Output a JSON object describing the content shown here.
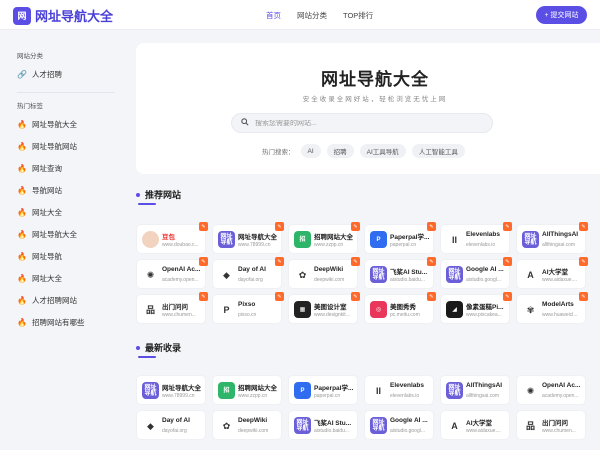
{
  "header": {
    "logo_mark": "网",
    "logo_text": "网址导航大全",
    "nav": [
      "首页",
      "网站分类",
      "TOP排行"
    ],
    "submit_label": "+ 提交网站"
  },
  "sidebar": {
    "category_title": "网站分类",
    "category_item": "人才招聘",
    "hot_title": "热门标签",
    "hot_items": [
      "网址导航大全",
      "网址导航网站",
      "网址查询",
      "导航网站",
      "网址大全",
      "网址导航大全",
      "网址导航",
      "网址大全",
      "人才招聘网站",
      "招聘网站有哪些"
    ]
  },
  "hero": {
    "title": "网址导航大全",
    "subtitle": "安全收录全网好站，轻松浏览无忧上网",
    "search_placeholder": "搜索您需要的网站...",
    "hot_label": "热门搜索：",
    "hot_tags": [
      "AI",
      "招聘",
      "AI工具导航",
      "人工智能工具"
    ]
  },
  "recommended": {
    "title": "推荐网站",
    "cards": [
      {
        "name": "豆包",
        "url": "www.doubao.c...",
        "icon": "doubao-icon",
        "color": "#f2d3c0",
        "mark": "",
        "red": true
      },
      {
        "name": "网址导航大全",
        "url": "www.78999.cn",
        "icon": "wangzhi-icon",
        "color": "#6a5fd8",
        "mark": "网址\n导航"
      },
      {
        "name": "招聘网站大全",
        "url": "www.zzpp.cn",
        "icon": "zhaopin-icon",
        "color": "#2fb56a",
        "mark": "招"
      },
      {
        "name": "Paperpal学...",
        "url": "paperpal.cn",
        "icon": "paperpal-icon",
        "color": "#2f6cf0",
        "mark": "P"
      },
      {
        "name": "Elevenlabs",
        "url": "elevenlabs.io",
        "icon": "elevenlabs-icon",
        "color": "#ffffff",
        "mark": "II"
      },
      {
        "name": "AllThingsAI",
        "url": "allthingsai.com",
        "icon": "allthingsai-icon",
        "color": "#6a5fd8",
        "mark": "网址\n导航"
      },
      {
        "name": "OpenAI Ac...",
        "url": "academy.open...",
        "icon": "openai-icon",
        "color": "#ffffff",
        "mark": "✺"
      },
      {
        "name": "Day of AI",
        "url": "dayofai.org",
        "icon": "dayofai-icon",
        "color": "#ffffff",
        "mark": "◆"
      },
      {
        "name": "DeepWiki",
        "url": "deepwiki.com",
        "icon": "deepwiki-icon",
        "color": "#ffffff",
        "mark": "✿"
      },
      {
        "name": "飞桨AI Stu...",
        "url": "aistudio.baidu...",
        "icon": "feijiang-icon",
        "color": "#6a5fd8",
        "mark": "网址\n导航"
      },
      {
        "name": "Google AI ...",
        "url": "aistudio.googl...",
        "icon": "googleai-icon",
        "color": "#6a5fd8",
        "mark": "网址\n导航"
      },
      {
        "name": "AI大学堂",
        "url": "www.aidaxue....",
        "icon": "aidaxue-icon",
        "color": "#ffffff",
        "mark": "A"
      },
      {
        "name": "出门问问",
        "url": "www.chumen...",
        "icon": "chumen-icon",
        "color": "#ffffff",
        "mark": "品"
      },
      {
        "name": "Pixso",
        "url": "pixso.cn",
        "icon": "pixso-icon",
        "color": "#ffffff",
        "mark": "P"
      },
      {
        "name": "美图设计室",
        "url": "www.designkit...",
        "icon": "meitu-design-icon",
        "color": "#222222",
        "mark": "▦"
      },
      {
        "name": "美图秀秀",
        "url": "pc.meitu.com",
        "icon": "meitu-icon",
        "color": "#e8375a",
        "mark": "◎"
      },
      {
        "name": "像素蛋糕Pi...",
        "url": "www.pixcakea...",
        "icon": "pixcake-icon",
        "color": "#1a1a1a",
        "mark": "◢"
      },
      {
        "name": "ModelArts",
        "url": "www.huaweicl...",
        "icon": "modelarts-icon",
        "color": "#ffffff",
        "mark": "✾"
      }
    ]
  },
  "latest": {
    "title": "最新收录",
    "cards": [
      {
        "name": "网址导航大全",
        "url": "www.78999.cn",
        "icon": "wangzhi-icon",
        "color": "#6a5fd8",
        "mark": "网址\n导航"
      },
      {
        "name": "招聘网站大全",
        "url": "www.zzpp.cn",
        "icon": "zhaopin-icon",
        "color": "#2fb56a",
        "mark": "招"
      },
      {
        "name": "Paperpal学...",
        "url": "paperpal.cn",
        "icon": "paperpal-icon",
        "color": "#2f6cf0",
        "mark": "P"
      },
      {
        "name": "Elevenlabs",
        "url": "elevenlabs.io",
        "icon": "elevenlabs-icon",
        "color": "#ffffff",
        "mark": "II"
      },
      {
        "name": "AllThingsAI",
        "url": "allthingsai.com",
        "icon": "allthingsai-icon",
        "color": "#6a5fd8",
        "mark": "网址\n导航"
      },
      {
        "name": "OpenAI Ac...",
        "url": "academy.open...",
        "icon": "openai-icon",
        "color": "#ffffff",
        "mark": "✺"
      },
      {
        "name": "Day of AI",
        "url": "dayofai.org",
        "icon": "dayofai-icon",
        "color": "#ffffff",
        "mark": "◆"
      },
      {
        "name": "DeepWiki",
        "url": "deepwiki.com",
        "icon": "deepwiki-icon",
        "color": "#ffffff",
        "mark": "✿"
      },
      {
        "name": "飞桨AI Stu...",
        "url": "aistudio.baidu...",
        "icon": "feijiang-icon",
        "color": "#6a5fd8",
        "mark": "网址\n导航"
      },
      {
        "name": "Google AI ...",
        "url": "aistudio.googl...",
        "icon": "googleai-icon",
        "color": "#6a5fd8",
        "mark": "网址\n导航"
      },
      {
        "name": "AI大学堂",
        "url": "www.aidaxue....",
        "icon": "aidaxue-icon",
        "color": "#ffffff",
        "mark": "A"
      },
      {
        "name": "出门问问",
        "url": "www.chumen...",
        "icon": "chumen-icon",
        "color": "#ffffff",
        "mark": "品"
      }
    ]
  },
  "colors": {
    "accent": "#5b4ee5",
    "hot_badge": "#ff6a2b"
  }
}
